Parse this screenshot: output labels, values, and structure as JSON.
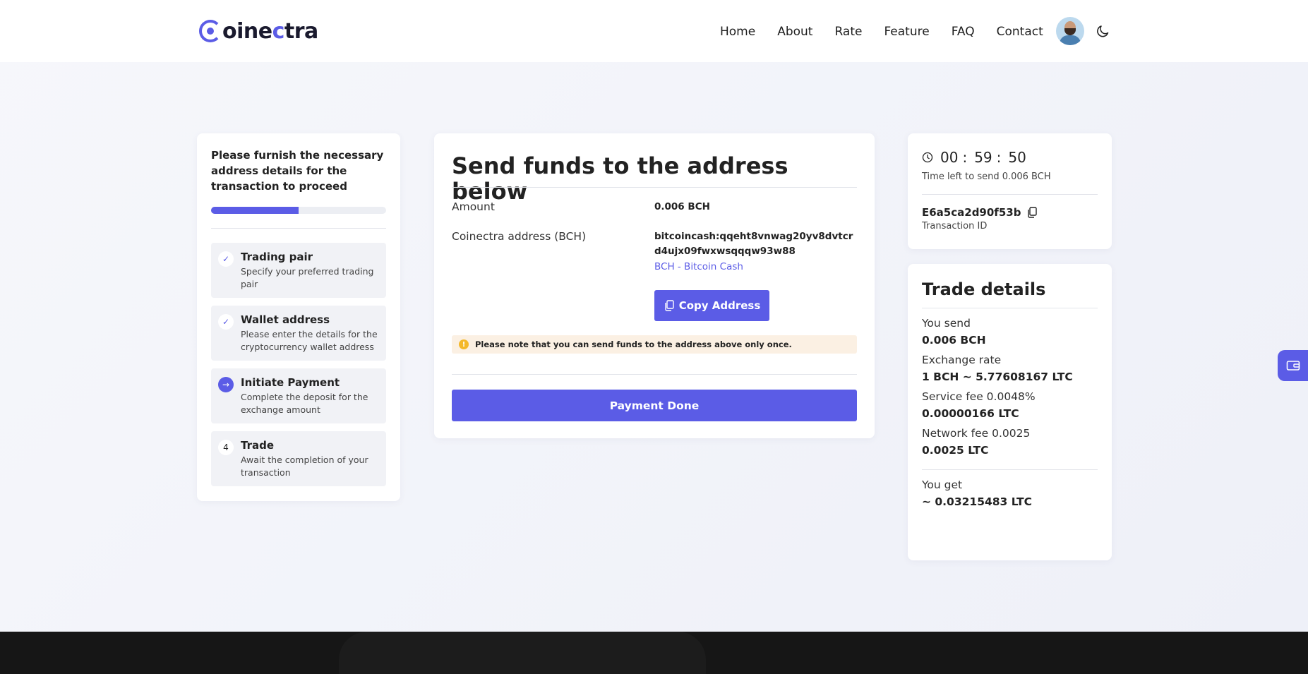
{
  "brand": {
    "logo_text_start": "oine",
    "logo_text_accent": "c",
    "logo_text_end": "tra",
    "accent_color": "#5b5ce6"
  },
  "nav": {
    "items": [
      {
        "label": "Home"
      },
      {
        "label": "About"
      },
      {
        "label": "Rate"
      },
      {
        "label": "Feature"
      },
      {
        "label": "FAQ"
      },
      {
        "label": "Contact"
      }
    ],
    "avatar_icon": "user-avatar",
    "theme_icon": "moon-icon"
  },
  "steps": {
    "title": "Please furnish the necessary address details for the transaction to proceed",
    "progress": 0.5,
    "items": [
      {
        "marker": "✓",
        "title": "Trading pair",
        "desc": "Specify your preferred trading pair",
        "state": "done"
      },
      {
        "marker": "✓",
        "title": "Wallet address",
        "desc": "Please enter the details for the cryptocurrency wallet address",
        "state": "done"
      },
      {
        "marker": "→",
        "title": "Initiate Payment",
        "desc": "Complete the deposit for the exchange amount",
        "state": "active"
      },
      {
        "marker": "4",
        "title": "Trade",
        "desc": "Await the completion of your transaction",
        "state": "pending"
      }
    ]
  },
  "send": {
    "title": "Send funds to the address below",
    "amount_label": "Amount",
    "amount_value": "0.006 BCH",
    "address_label": "Coinectra address (BCH)",
    "address_value": "bitcoincash:qqeht8vnwag20yv8dvtcrd4ujx09fwxwsqqqw93w88",
    "coin_link": "BCH - Bitcoin Cash",
    "copy_button": "Copy Address",
    "notice_icon": "!",
    "notice": "Please note that you can send funds to the address above only once.",
    "pay_button": "Payment Done"
  },
  "timer": {
    "hours": "00",
    "minutes": "59",
    "seconds": "50",
    "sep": ":",
    "caption": "Time left to send 0.006 BCH",
    "tx_id": "E6a5ca2d90f53b",
    "tx_label": "Transaction ID"
  },
  "trade": {
    "title": "Trade details",
    "you_send_label": "You send",
    "you_send_value": "0.006 BCH",
    "rate_label": "Exchange rate",
    "rate_value": "1 BCH ~ 5.77608167 LTC",
    "service_label": "Service fee 0.0048%",
    "service_value": "0.00000166 LTC",
    "network_label": "Network fee 0.0025",
    "network_value": "0.0025 LTC",
    "you_get_label": "You get",
    "you_get_value": "~ 0.03215483 LTC"
  },
  "side_tab_icon": "wallet-icon"
}
